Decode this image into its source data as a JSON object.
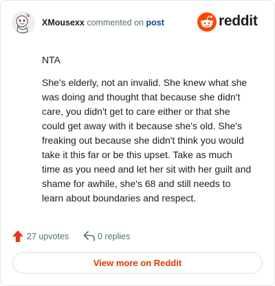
{
  "header": {
    "username": "XMousexx",
    "commented_on": "commented on",
    "post_link": "post",
    "brand_word": "reddit"
  },
  "comment": {
    "paragraphs": [
      "NTA",
      "She's elderly, not an invalid. She knew what she was doing and thought that because she didn't care, you didn't get to care either or that she could get away with it because she's old. She's freaking out because she didn't think you would take it this far or be this upset. Take as much time as you need and let her sit with her guilt and shame for awhile, she's 68 and still needs to learn about boundaries and respect."
    ]
  },
  "actions": {
    "upvotes_label": "27 upvotes",
    "replies_label": "0 replies"
  },
  "footer": {
    "view_more_label": "View more on Reddit"
  },
  "icons": {
    "avatar": "snoo-avatar-icon",
    "brand": "reddit-logo-icon",
    "upvote": "upvote-arrow-icon",
    "reply": "reply-arrow-icon"
  },
  "colors": {
    "brand_orange": "#ff4500",
    "upvote_orange": "#e5361a",
    "link_blue": "#0a449b",
    "meta_gray": "#576f76",
    "view_more_text": "#d93900",
    "border": "#e5e5e5"
  }
}
